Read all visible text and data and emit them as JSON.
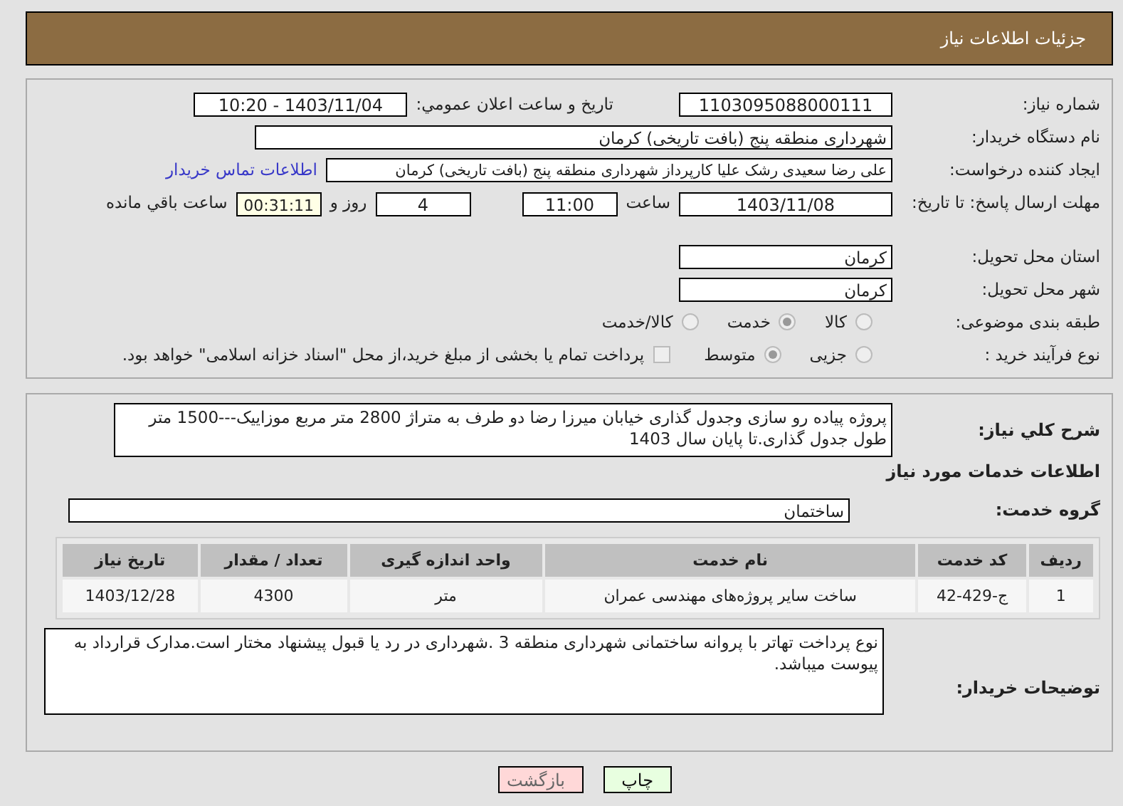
{
  "header": {
    "title": "جزئیات اطلاعات نیاز"
  },
  "details": {
    "need_number": {
      "label": "شماره نیاز:",
      "value": "1103095088000111"
    },
    "announce": {
      "label": "تاريخ و ساعت اعلان عمومي:",
      "value": "1403/11/04 - 10:20"
    },
    "buyer": {
      "label": "نام دستگاه خریدار:",
      "value": "شهرداری منطقه پنج (بافت تاریخی) کرمان"
    },
    "creator": {
      "label": "ایجاد کننده درخواست:",
      "value": "علی رضا سعیدی رشک علیا کارپرداز شهرداری منطقه پنج (بافت تاریخی) کرمان",
      "link": "اطلاعات تماس خریدار"
    },
    "deadline": {
      "label": "مهلت ارسال پاسخ: تا تاریخ:",
      "date": "1403/11/08",
      "time_label": "ساعت",
      "time": "11:00",
      "days": "4",
      "days_label": "روز و",
      "remaining": "00:31:11",
      "remaining_label": "ساعت باقي مانده"
    },
    "province": {
      "label": "استان محل تحویل:",
      "value": "کرمان"
    },
    "city": {
      "label": "شهر محل تحویل:",
      "value": "کرمان"
    },
    "category": {
      "label": "طبقه بندی موضوعی:",
      "options": [
        {
          "label": "کالا",
          "selected": false
        },
        {
          "label": "خدمت",
          "selected": true
        },
        {
          "label": "کالا/خدمت",
          "selected": false
        }
      ]
    },
    "process": {
      "label": "نوع فرآیند خرید :",
      "options": [
        {
          "label": "جزیی",
          "selected": false
        },
        {
          "label": "متوسط",
          "selected": true
        }
      ],
      "treasury": {
        "checked": false,
        "label": "پرداخت تمام یا بخشی از مبلغ خرید،از محل \"اسناد خزانه اسلامی\" خواهد بود."
      }
    }
  },
  "needs": {
    "description": {
      "label": "شرح کلي نیاز:",
      "value": "پروژه   پیاده رو سازی  وجدول گذاری خیابان میرزا رضا دو طرف به متراژ 2800  متر مربع موزاییک---1500 متر طول جدول گذاری.تا پایان سال 1403"
    },
    "services_title": "اطلاعات خدمات مورد نیاز",
    "service_group": {
      "label": "گروه خدمت:",
      "value": "ساختمان"
    },
    "table": {
      "columns": [
        "ردیف",
        "کد خدمت",
        "نام خدمت",
        "واحد اندازه گیری",
        "تعداد / مقدار",
        "تاریخ نیاز"
      ],
      "rows": [
        [
          "1",
          "ج-429-42",
          "ساخت سایر پروژه‌های مهندسی عمران",
          "متر",
          "4300",
          "1403/12/28"
        ]
      ]
    },
    "buyer_notes": {
      "label": "توضیحات خریدار:",
      "value": "نوع پرداخت تهاتر با پروانه ساختمانی شهرداری منطقه 3 .شهرداری در رد یا قبول پیشنهاد مختار است.مدارک قرارداد به پیوست میباشد."
    }
  },
  "buttons": [
    {
      "label": "چاپ",
      "kind": "print"
    },
    {
      "label": "بازگشت",
      "kind": "back"
    }
  ]
}
